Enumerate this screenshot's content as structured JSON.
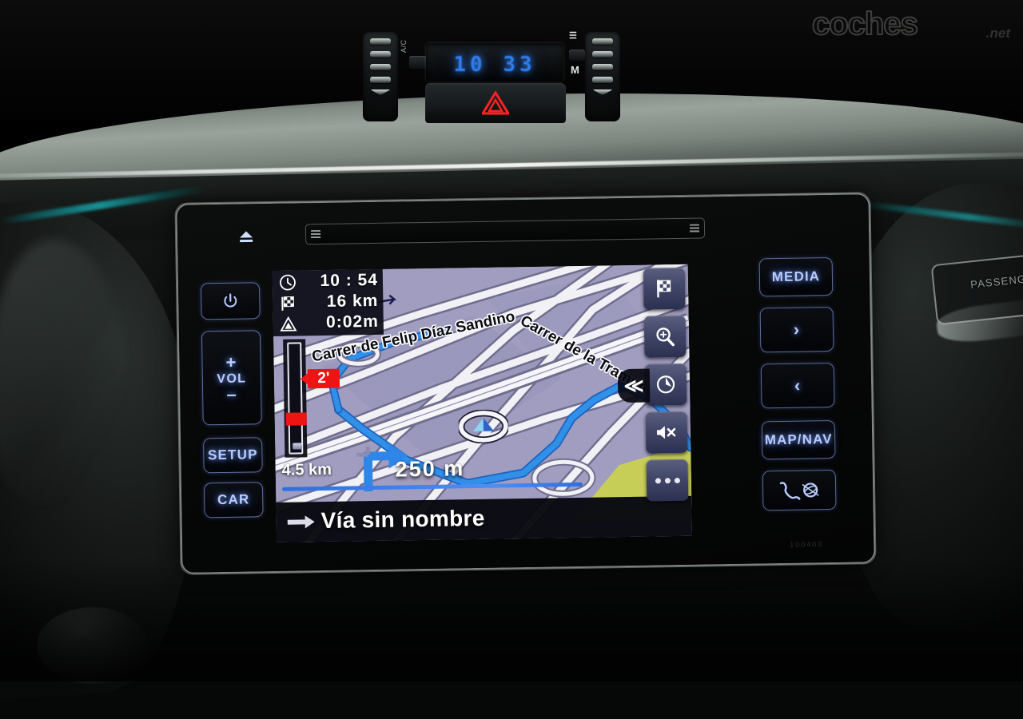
{
  "watermark": {
    "main": "coches",
    "sub": ".net"
  },
  "climate": {
    "clock": "10 33",
    "ac_label": "A/C",
    "mode_label": "M",
    "hazard_name": "hazard-warning-button"
  },
  "head_unit": {
    "eject_label": "eject",
    "unit_code": "100403",
    "left_buttons": [
      {
        "name": "power-button",
        "label": "⏻"
      },
      {
        "name": "volume-button",
        "plus": "+",
        "label": "VOL",
        "minus": "–"
      },
      {
        "name": "setup-button",
        "label": "SETUP"
      },
      {
        "name": "car-button",
        "label": "CAR"
      }
    ],
    "right_buttons": [
      {
        "name": "media-button",
        "label": "MEDIA"
      },
      {
        "name": "next-button",
        "label": "›"
      },
      {
        "name": "prev-button",
        "label": "‹"
      },
      {
        "name": "map-nav-button",
        "label": "MAP/NAV"
      },
      {
        "name": "phone-button",
        "label": "phone-globe-icon"
      }
    ]
  },
  "screen": {
    "nav": {
      "eta_time": "10 : 54",
      "remaining_distance": "16 km",
      "remaining_time": "0:02m",
      "icons": {
        "eta": "clock-icon",
        "distance": "checkered-flag-icon",
        "warning": "traffic-warning-icon"
      },
      "traffic_delay": "2'",
      "segment_distance": "4.5 km",
      "next_turn_distance": "250 m",
      "next_street": "Vía sin nombre",
      "turn_direction": "turn-right",
      "street_labels": [
        "Carrer de Felip Díaz Sandino",
        "Carrer de la Tramunt"
      ],
      "collapse_label": "≪"
    },
    "soft_buttons": [
      {
        "name": "destination-flag-button",
        "icon": "checkered-flag-icon"
      },
      {
        "name": "zoom-button",
        "icon": "magnifier-plus-icon"
      },
      {
        "name": "orientation-button",
        "icon": "compass-north-up-icon"
      },
      {
        "name": "mute-button",
        "icon": "speaker-mute-icon"
      },
      {
        "name": "more-options-button",
        "icon": "ellipsis-icon"
      }
    ]
  },
  "dashboard": {
    "passenger_label": "PASSENGER"
  },
  "colors": {
    "map_land": "#a09dc0",
    "map_park": "#c8cf56",
    "route_blue": "#2e8fe8",
    "road_white": "#f2f2f7",
    "accent_blue": "#b9ccff",
    "traffic_red": "#ef1414",
    "lcd_blue": "#2f7ef0"
  }
}
